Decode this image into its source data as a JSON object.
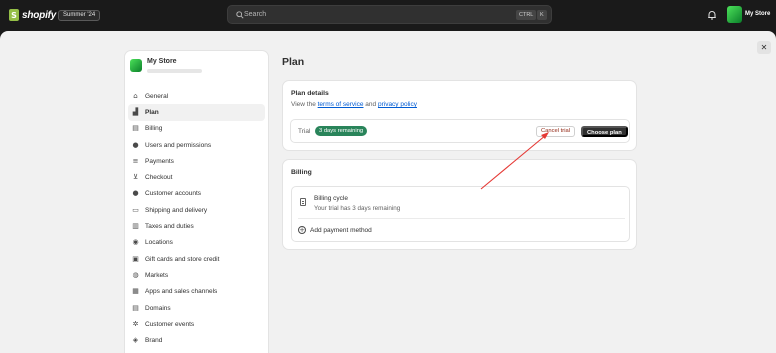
{
  "topbar": {
    "logo_glyph": "S",
    "logo_text": "shopify",
    "edition_badge": "Summer '24",
    "search_placeholder": "Search",
    "shortcut_ctrl": "CTRL",
    "shortcut_key": "K",
    "store_name": "My Store"
  },
  "sidebar": {
    "store_name": "My Store",
    "items": [
      {
        "label": "General",
        "icon": "store-icon",
        "glyph": "⌂"
      },
      {
        "label": "Plan",
        "icon": "plan-chart-icon",
        "glyph": "▟",
        "active": true
      },
      {
        "label": "Billing",
        "icon": "billing-icon",
        "glyph": "▤"
      },
      {
        "label": "Users and permissions",
        "icon": "users-icon",
        "glyph": "●"
      },
      {
        "label": "Payments",
        "icon": "payments-icon",
        "glyph": "≡"
      },
      {
        "label": "Checkout",
        "icon": "cart-icon",
        "glyph": "⊻"
      },
      {
        "label": "Customer accounts",
        "icon": "person-icon",
        "glyph": "●"
      },
      {
        "label": "Shipping and delivery",
        "icon": "truck-icon",
        "glyph": "▭"
      },
      {
        "label": "Taxes and duties",
        "icon": "taxes-icon",
        "glyph": "▥"
      },
      {
        "label": "Locations",
        "icon": "location-pin-icon",
        "glyph": "◉"
      },
      {
        "label": "Gift cards and store credit",
        "icon": "gift-card-icon",
        "glyph": "▣"
      },
      {
        "label": "Markets",
        "icon": "globe-icon",
        "glyph": "◍"
      },
      {
        "label": "Apps and sales channels",
        "icon": "apps-icon",
        "glyph": "▦"
      },
      {
        "label": "Domains",
        "icon": "domain-icon",
        "glyph": "▤"
      },
      {
        "label": "Customer events",
        "icon": "events-icon",
        "glyph": "✲"
      },
      {
        "label": "Brand",
        "icon": "brand-icon",
        "glyph": "◈"
      }
    ]
  },
  "main": {
    "title": "Plan",
    "plan_card": {
      "title": "Plan details",
      "desc_prefix": "View the ",
      "terms_link": "terms of service",
      "desc_and": " and ",
      "privacy_link": "privacy policy",
      "trial_label": "Trial",
      "trial_badge": "3 days remaining",
      "cancel_button": "Cancel trial",
      "choose_button": "Choose plan"
    },
    "billing_card": {
      "title": "Billing",
      "cycle_title": "Billing cycle",
      "cycle_sub": "Your trial has 3 days remaining",
      "add_payment": "Add payment method"
    }
  },
  "close_glyph": "✕",
  "colors": {
    "accent_green": "#29845a",
    "danger_text": "#8e1f0b",
    "link_blue": "#005bd3",
    "annotation_red": "#e53935"
  }
}
